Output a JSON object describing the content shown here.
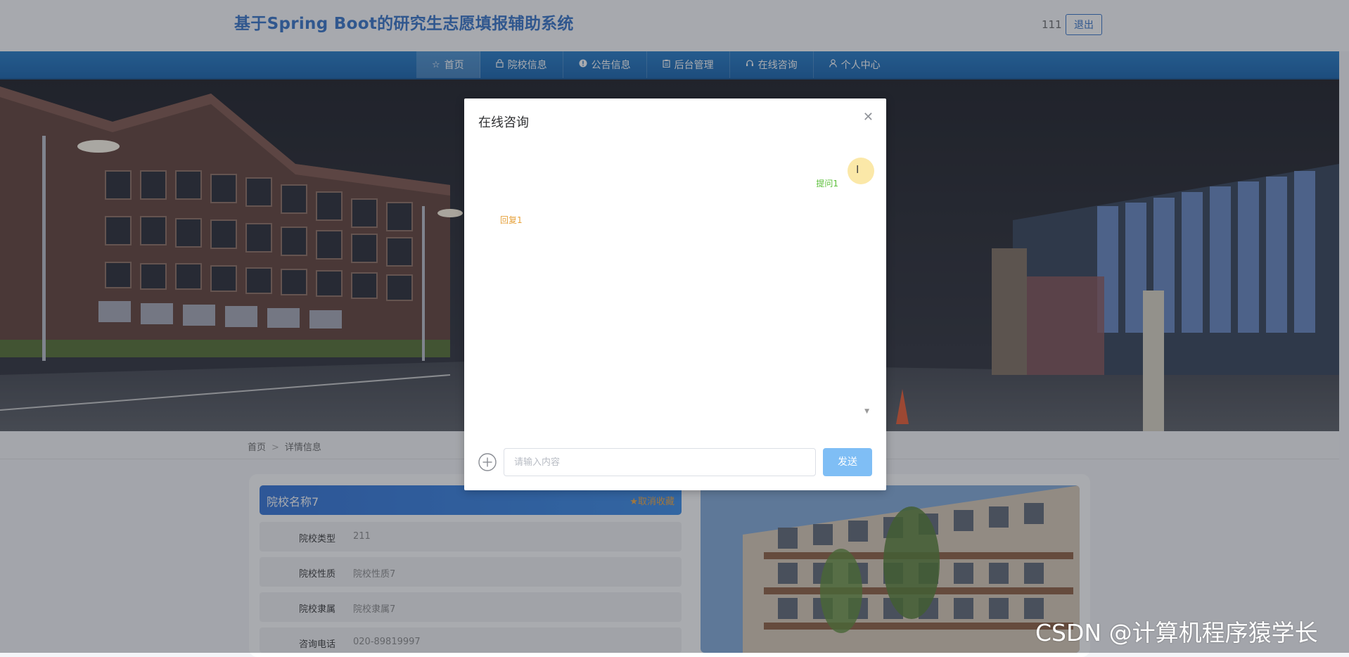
{
  "header": {
    "title": "基于Spring Boot的研究生志愿填报辅助系统",
    "username": "111",
    "logout_label": "退出"
  },
  "nav": {
    "items": [
      {
        "label": "首页",
        "icon": "star-icon",
        "active": true
      },
      {
        "label": "院校信息",
        "icon": "lock-icon",
        "active": false
      },
      {
        "label": "公告信息",
        "icon": "info-icon",
        "active": false
      },
      {
        "label": "后台管理",
        "icon": "clipboard-icon",
        "active": false
      },
      {
        "label": "在线咨询",
        "icon": "headset-icon",
        "active": false
      },
      {
        "label": "个人中心",
        "icon": "user-icon",
        "active": false
      }
    ]
  },
  "breadcrumb": {
    "home": "首页",
    "separator": ">",
    "current": "详情信息"
  },
  "detail": {
    "name": "院校名称7",
    "favorite_label": "★取消收藏",
    "rows": [
      {
        "label": "院校类型",
        "value": "211"
      },
      {
        "label": "院校性质",
        "value": "院校性质7"
      },
      {
        "label": "院校隶属",
        "value": "院校隶属7"
      },
      {
        "label": "咨询电话",
        "value": "020-89819997"
      }
    ]
  },
  "modal": {
    "title": "在线咨询",
    "close_icon": "close-icon",
    "messages": [
      {
        "role": "ask",
        "text": "提问1",
        "color": "#5bbf39"
      },
      {
        "role": "reply",
        "text": "回复1",
        "color": "#e6a23c"
      }
    ],
    "input_placeholder": "请输入内容",
    "send_label": "发送"
  },
  "watermark": "CSDN @计算机程序猿学长",
  "colors": {
    "brand": "#2f6fc7",
    "nav": "#1669b8",
    "send": "#7fbef5"
  }
}
